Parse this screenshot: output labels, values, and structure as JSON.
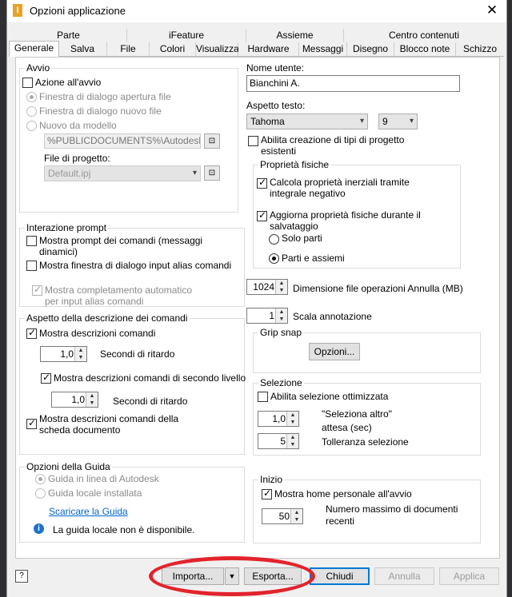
{
  "window": {
    "title": "Opzioni applicazione",
    "close_glyph": "✕"
  },
  "tabs_row1": [
    "Parte",
    "iFeature",
    "Assieme",
    "Centro contenuti"
  ],
  "tabs_row2": [
    "Generale",
    "Salva",
    "File",
    "Colori",
    "Visualizza",
    "Hardware",
    "Messaggi",
    "Disegno",
    "Blocco note",
    "Schizzo"
  ],
  "selected_tab": "Generale",
  "avvio": {
    "legend": "Avvio",
    "action_label": "Azione all'avvio",
    "radio_open": "Finestra di dialogo apertura file",
    "radio_new": "Finestra di dialogo nuovo file",
    "radio_model": "Nuovo da modello",
    "model_path": "%PUBLICDOCUMENTS%\\Autodesk\\Ir",
    "project_label": "File di progetto:",
    "project_value": "Default.ipj"
  },
  "prompt": {
    "legend": "Interazione prompt",
    "cmd_prompt": "Mostra prompt dei comandi (messaggi dinamici)",
    "alias_dialog": "Mostra finestra di dialogo input alias comandi",
    "autocomplete": "Mostra completamento automatico per input alias comandi"
  },
  "tooltip": {
    "legend": "Aspetto della descrizione dei comandi",
    "show_tooltips": "Mostra descrizioni comandi",
    "delay1_value": "1,0",
    "delay_label": "Secondi di ritardo",
    "second_level": "Mostra descrizioni comandi di secondo livello",
    "delay2_value": "1,0",
    "doc_tab": "Mostra descrizioni comandi della scheda documento"
  },
  "guida": {
    "legend": "Opzioni della Guida",
    "online": "Guida in linea di Autodesk",
    "local": "Guida locale installata",
    "download_link": "Scaricare la Guida",
    "info_text": "La guida locale non è disponibile."
  },
  "user": {
    "label": "Nome utente:",
    "value": "Bianchini A."
  },
  "text_style": {
    "label": "Aspetto testo:",
    "font": "Tahoma",
    "size": "9"
  },
  "project_types": "Abilita creazione di tipi di progetto esistenti",
  "physical": {
    "legend": "Proprietà fisiche",
    "inertial": "Calcola proprietà inerziali tramite integrale negativo",
    "update_on_save": "Aggiorna proprietà fisiche durante il salvataggio",
    "parts_only": "Solo parti",
    "parts_assemblies": "Parti e assiemi"
  },
  "undo": {
    "value": "1024",
    "label": "Dimensione file operazioni Annulla (MB)"
  },
  "annotation": {
    "value": "1",
    "label": "Scala annotazione"
  },
  "grip": {
    "legend": "Grip snap",
    "options_button": "Opzioni..."
  },
  "selection": {
    "legend": "Selezione",
    "optimized": "Abilita selezione ottimizzata",
    "select_other_value": "1,0",
    "select_other_label": "\"Seleziona altro\" attesa (sec)",
    "tolerance_value": "5",
    "tolerance_label": "Tolleranza selezione"
  },
  "home": {
    "legend": "Inizio",
    "show_home": "Mostra home personale all'avvio",
    "max_docs_value": "50",
    "max_docs_label": "Numero massimo di documenti recenti"
  },
  "footer": {
    "help_glyph": "?",
    "import": "Importa...",
    "export": "Esporta...",
    "close": "Chiudi",
    "undo": "Annulla",
    "apply": "Applica"
  },
  "colors": {
    "highlight_ring": "#e3232c",
    "link": "#0066cc",
    "default_button_border": "#0078d7"
  }
}
